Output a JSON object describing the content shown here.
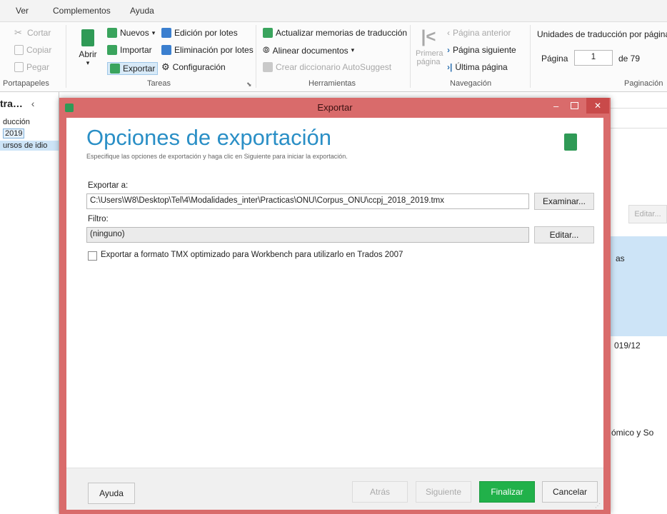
{
  "menubar": {
    "items": [
      "Ver",
      "Complementos",
      "Ayuda"
    ]
  },
  "ribbon": {
    "clipboard": {
      "cut": "Cortar",
      "copy": "Copiar",
      "paste": "Pegar",
      "group": "Portapapeles"
    },
    "tasks": {
      "open": "Abrir",
      "new": "Nuevos",
      "import": "Importar",
      "export": "Exportar",
      "batch_edit": "Edición por lotes",
      "batch_delete": "Eliminación por lotes",
      "settings": "Configuración",
      "group": "Tareas"
    },
    "tools": {
      "update_tm": "Actualizar memorias de traducción",
      "align": "Alinear documentos",
      "autosuggest": "Crear diccionario AutoSuggest",
      "group": "Herramientas"
    },
    "navigation": {
      "first1": "Primera",
      "first2": "página",
      "prev": "Página anterior",
      "next": "Página siguiente",
      "last": "Última página",
      "group": "Navegación"
    },
    "paging": {
      "title": "Unidades de traducción por página",
      "page_label": "Página",
      "page_value": "1",
      "of": "de 79",
      "group": "Paginación"
    }
  },
  "leftpane": {
    "title": "tra…",
    "items": [
      "ducción",
      "2019",
      "ursos de idio"
    ]
  },
  "rightpane": {
    "edit_button": "Editar...",
    "text1": "as",
    "text2": "019/12",
    "text3": "ómico y So"
  },
  "dialog": {
    "title": "Exportar",
    "heading": "Opciones de exportación",
    "subheading": "Especifique las opciones de exportación y haga clic en Siguiente para iniciar la exportación.",
    "export_to_label": "Exportar a:",
    "export_path": "C:\\Users\\W8\\Desktop\\Tel\\4\\Modalidades_inter\\Practicas\\ONU\\Corpus_ONU\\ccpj_2018_2019.tmx",
    "browse_button": "Examinar...",
    "filter_label": "Filtro:",
    "filter_value": "(ninguno)",
    "edit_button": "Editar...",
    "checkbox_label": "Exportar a formato TMX optimizado para Workbench para utilizarlo en Trados 2007",
    "footer": {
      "help": "Ayuda",
      "back": "Atrás",
      "next": "Siguiente",
      "finish": "Finalizar",
      "cancel": "Cancelar"
    }
  },
  "colors": {
    "dialog_frame": "#d96b6b",
    "accent_blue": "#2a8fc6",
    "finish_green": "#21b14a"
  }
}
